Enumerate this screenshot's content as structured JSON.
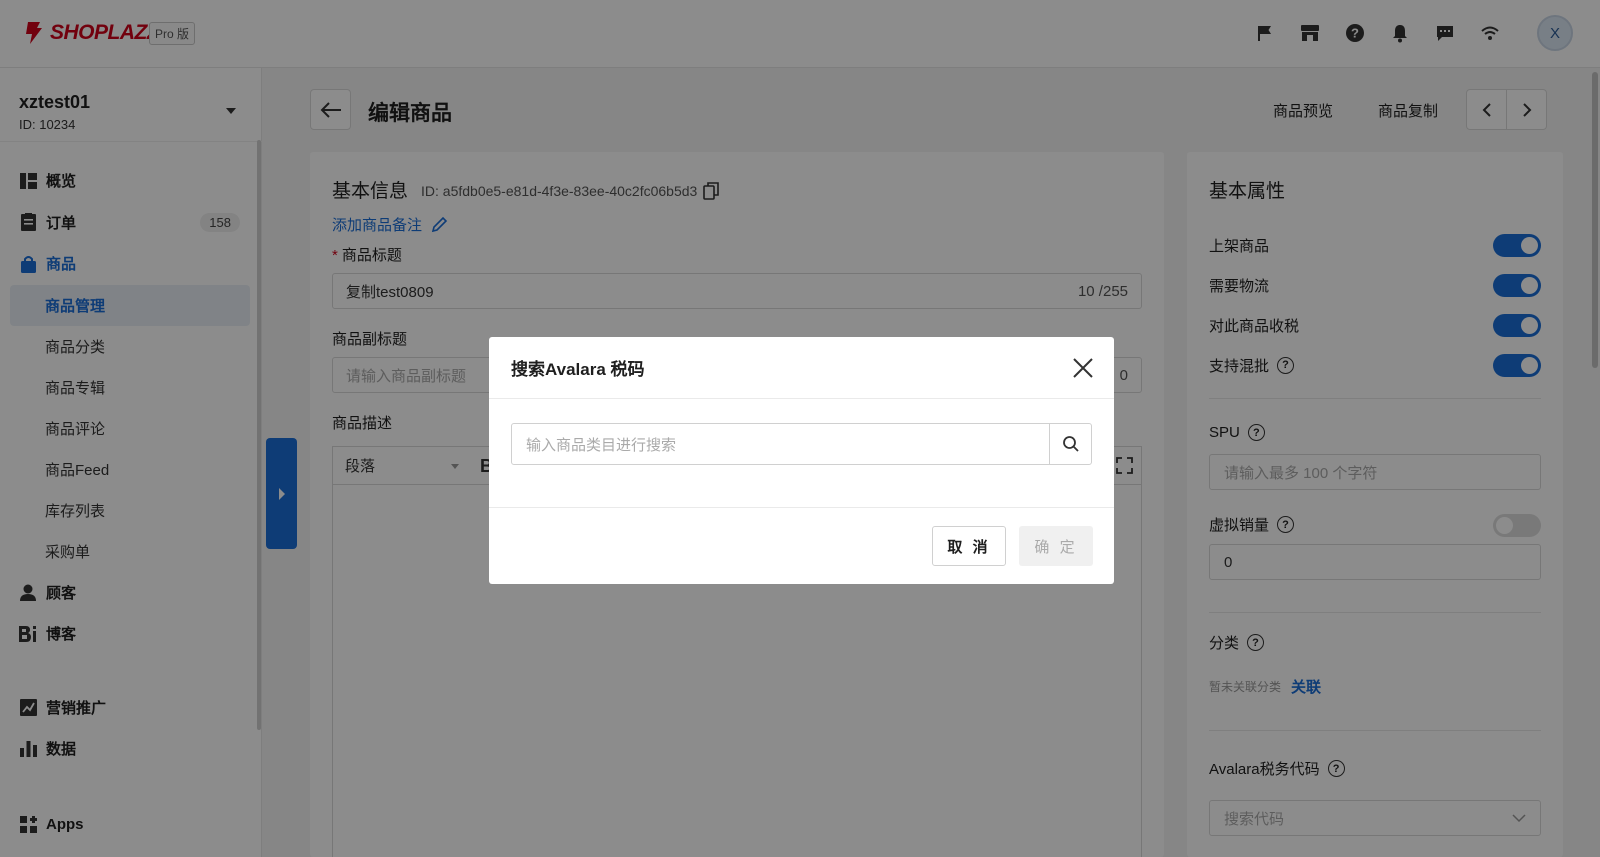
{
  "topbar": {
    "logo_text": "SHOPLAZZA",
    "plan_badge": "Pro 版",
    "icons": [
      "flag-icon",
      "store-icon",
      "help-icon",
      "bell-icon",
      "message-icon",
      "wifi-icon"
    ],
    "avatar_letter": "X"
  },
  "sidebar": {
    "store_name": "xztest01",
    "store_id": "ID: 10234",
    "items": [
      {
        "label": "概览",
        "icon": "overview-icon"
      },
      {
        "label": "订单",
        "icon": "orders-icon",
        "badge": "158"
      },
      {
        "label": "商品",
        "icon": "products-icon"
      },
      {
        "label": "商品管理",
        "active": true
      },
      {
        "label": "商品分类"
      },
      {
        "label": "商品专辑"
      },
      {
        "label": "商品评论"
      },
      {
        "label": "商品Feed"
      },
      {
        "label": "库存列表"
      },
      {
        "label": "采购单"
      },
      {
        "label": "顾客",
        "icon": "customers-icon"
      },
      {
        "label": "博客",
        "icon": "blog-icon"
      },
      {
        "label": "营销推广",
        "icon": "marketing-icon"
      },
      {
        "label": "数据",
        "icon": "data-icon"
      },
      {
        "label": "Apps",
        "icon": "apps-icon"
      }
    ]
  },
  "header": {
    "title": "编辑商品",
    "preview_label": "商品预览",
    "copy_label": "商品复制"
  },
  "basic_info": {
    "title": "基本信息",
    "id_text": "ID: a5fdb0e5-e81d-4f3e-83ee-40c2fc06b5d3",
    "note_link": "添加商品备注",
    "product_title_label": "商品标题",
    "product_title_value": "复制test0809",
    "product_title_count": "10 /255",
    "subtitle_label": "商品副标题",
    "subtitle_placeholder": "请输入商品副标题",
    "subtitle_count_partial": "0",
    "desc_label": "商品描述",
    "editor_paragraph": "段落",
    "editor_bold": "B"
  },
  "attributes": {
    "title": "基本属性",
    "toggles": [
      {
        "label": "上架商品",
        "on": true
      },
      {
        "label": "需要物流",
        "on": true
      },
      {
        "label": "对此商品收税",
        "on": true
      },
      {
        "label": "支持混批",
        "on": true,
        "help": true
      }
    ],
    "spu_label": "SPU",
    "spu_placeholder": "请输入最多 100 个字符",
    "virtual_sales_label": "虚拟销量",
    "virtual_sales_on": false,
    "virtual_sales_value": "0",
    "category_label": "分类",
    "category_empty": "暂未关联分类",
    "category_link": "关联",
    "avalara_label": "Avalara税务代码",
    "avalara_placeholder": "搜索代码"
  },
  "modal": {
    "title": "搜索Avalara 税码",
    "search_placeholder": "输入商品类目进行搜索",
    "cancel_label": "取 消",
    "ok_label": "确 定"
  },
  "colors": {
    "accent": "#1a6dd8",
    "brand": "#d0021b",
    "overlay": "rgba(0,0,0,0.45)"
  }
}
